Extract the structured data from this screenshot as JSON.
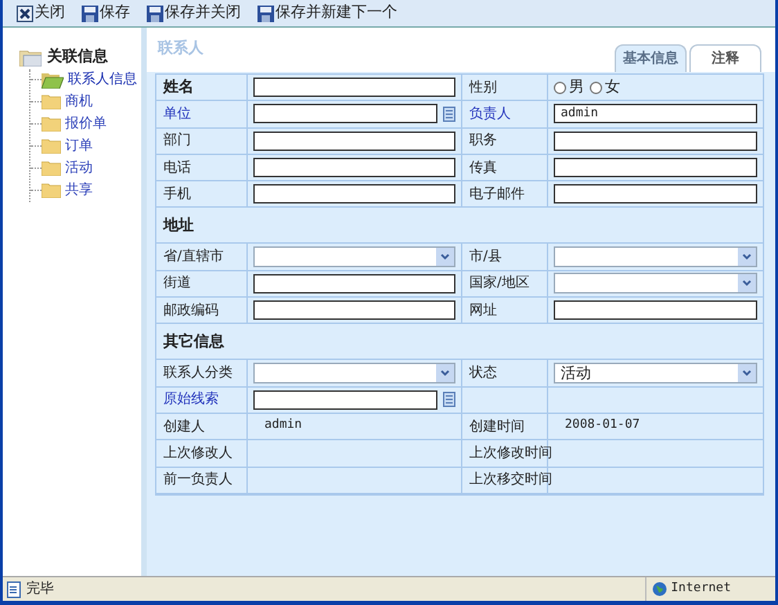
{
  "toolbar": [
    {
      "label": "关闭",
      "kind": "close"
    },
    {
      "label": "保存",
      "kind": "save"
    },
    {
      "label": "保存并关闭",
      "kind": "save"
    },
    {
      "label": "保存并新建下一个",
      "kind": "save"
    }
  ],
  "sidebar": {
    "title": "关联信息",
    "items": [
      {
        "label": "联系人信息",
        "selected": true
      },
      {
        "label": "商机",
        "selected": false
      },
      {
        "label": "报价单",
        "selected": false
      },
      {
        "label": "订单",
        "selected": false
      },
      {
        "label": "活动",
        "selected": false
      },
      {
        "label": "共享",
        "selected": false
      }
    ]
  },
  "main": {
    "title": "联系人",
    "tabs": [
      {
        "label": "基本信息",
        "selected": true
      },
      {
        "label": "注释",
        "selected": false
      }
    ],
    "rows": [
      {
        "kind": "fields",
        "left": {
          "label": "姓名",
          "bold": true,
          "link": false,
          "kind": "text"
        },
        "right": {
          "label": "性别",
          "bold": false,
          "link": false,
          "kind": "radio",
          "options": [
            {
              "label": "男",
              "selected": false
            },
            {
              "label": "女",
              "selected": false
            }
          ]
        }
      },
      {
        "kind": "fields",
        "left": {
          "label": "单位",
          "bold": false,
          "link": true,
          "kind": "lookup"
        },
        "right": {
          "label": "负责人",
          "bold": false,
          "link": true,
          "kind": "text",
          "value": "admin"
        }
      },
      {
        "kind": "fields",
        "left": {
          "label": "部门",
          "bold": false,
          "link": false,
          "kind": "text"
        },
        "right": {
          "label": "职务",
          "bold": false,
          "link": false,
          "kind": "text"
        }
      },
      {
        "kind": "fields",
        "left": {
          "label": "电话",
          "bold": false,
          "link": false,
          "kind": "text"
        },
        "right": {
          "label": "传真",
          "bold": false,
          "link": false,
          "kind": "text"
        }
      },
      {
        "kind": "fields",
        "left": {
          "label": "手机",
          "bold": false,
          "link": false,
          "kind": "text"
        },
        "right": {
          "label": "电子邮件",
          "bold": false,
          "link": false,
          "kind": "text"
        }
      },
      {
        "kind": "section",
        "title": "地址"
      },
      {
        "kind": "fields",
        "left": {
          "label": "省/直辖市",
          "bold": false,
          "link": false,
          "kind": "select"
        },
        "right": {
          "label": "市/县",
          "bold": false,
          "link": false,
          "kind": "select"
        }
      },
      {
        "kind": "fields",
        "left": {
          "label": "街道",
          "bold": false,
          "link": false,
          "kind": "text"
        },
        "right": {
          "label": "国家/地区",
          "bold": false,
          "link": false,
          "kind": "select"
        }
      },
      {
        "kind": "fields",
        "left": {
          "label": "邮政编码",
          "bold": false,
          "link": false,
          "kind": "text"
        },
        "right": {
          "label": "网址",
          "bold": false,
          "link": false,
          "kind": "text"
        }
      },
      {
        "kind": "section",
        "title": "其它信息"
      },
      {
        "kind": "fields",
        "left": {
          "label": "联系人分类",
          "bold": false,
          "link": false,
          "kind": "select"
        },
        "right": {
          "label": "状态",
          "bold": false,
          "link": false,
          "kind": "select",
          "value": "活动"
        }
      },
      {
        "kind": "fields",
        "left": {
          "label": "原始线索",
          "bold": false,
          "link": true,
          "kind": "lookup"
        }
      },
      {
        "kind": "fields",
        "left": {
          "label": "创建人",
          "bold": false,
          "link": false,
          "kind": "static",
          "value": "admin"
        },
        "right": {
          "label": "创建时间",
          "bold": false,
          "link": false,
          "kind": "static",
          "value": "2008-01-07"
        }
      },
      {
        "kind": "fields",
        "left": {
          "label": "上次修改人",
          "bold": false,
          "link": false,
          "kind": "static"
        },
        "right": {
          "label": "上次修改时间",
          "bold": false,
          "link": false,
          "kind": "static"
        }
      },
      {
        "kind": "fields",
        "left": {
          "label": "前一负责人",
          "bold": false,
          "link": false,
          "kind": "static"
        },
        "right": {
          "label": "上次移交时间",
          "bold": false,
          "link": false,
          "kind": "static"
        }
      }
    ]
  },
  "status_bar": {
    "text": "完毕",
    "zone": "Internet"
  }
}
